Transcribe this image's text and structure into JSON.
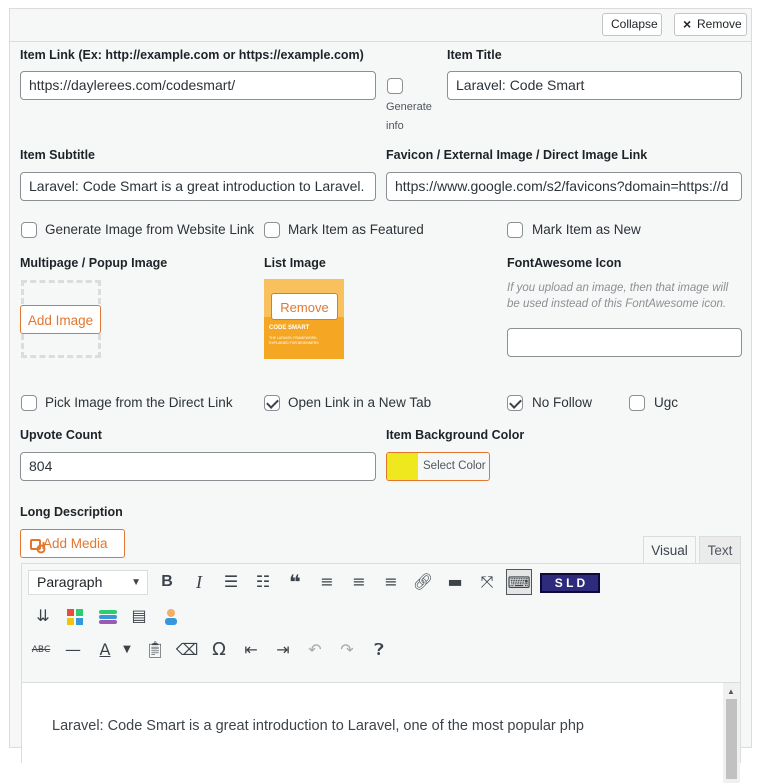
{
  "header": {
    "collapse_label": "Collapse",
    "remove_label": "Remove",
    "remove_icon": "×"
  },
  "fields": {
    "item_link": {
      "label": "Item Link (Ex: http://example.com or https://example.com)",
      "value": "https://daylerees.com/codesmart/"
    },
    "generate_info": {
      "label_line1": "Generate",
      "label_line2": "info",
      "checked": false
    },
    "item_title": {
      "label": "Item Title",
      "value": "Laravel: Code Smart"
    },
    "item_subtitle": {
      "label": "Item Subtitle",
      "value": "Laravel: Code Smart is a great introduction to Laravel."
    },
    "favicon": {
      "label": "Favicon / External Image / Direct Image Link",
      "value": "https://www.google.com/s2/favicons?domain=https://d"
    }
  },
  "checkboxes_row1": [
    {
      "label": "Generate Image from Website Link",
      "checked": false
    },
    {
      "label": "Mark Item as Featured",
      "checked": false
    },
    {
      "label": "Mark Item as New",
      "checked": false
    }
  ],
  "media": {
    "multipage_label": "Multipage / Popup Image",
    "add_image_label": "Add Image",
    "list_image_label": "List Image",
    "remove_label": "Remove",
    "thumb_title": "CODE SMART",
    "thumb_sub": "THE LARAVEL FRAMEWORK, EXPLAINED FOR BEGINNERS",
    "fa_label": "FontAwesome Icon",
    "fa_note": "If you upload an image, then that image will be used instead of this FontAwesome icon.",
    "fa_value": ""
  },
  "checkboxes_row2": [
    {
      "label": "Pick Image from the Direct Link",
      "checked": false
    },
    {
      "label": "Open Link in a New Tab",
      "checked": true
    },
    {
      "label": "No Follow",
      "checked": true
    },
    {
      "label": "Ugc",
      "checked": false
    }
  ],
  "upvote": {
    "label": "Upvote Count",
    "value": "804"
  },
  "bg_color": {
    "label": "Item Background Color",
    "button_label": "Select Color",
    "swatch": "#f0e81e"
  },
  "description": {
    "label": "Long Description",
    "add_media_label": "Add Media",
    "tab_visual": "Visual",
    "tab_text": "Text",
    "format_select": "Paragraph",
    "sld_label": "S L D",
    "content": "Laravel: Code Smart is a great introduction to Laravel, one of the most popular php"
  },
  "colors": {
    "accent": "#e27730",
    "border": "#8c8f94"
  }
}
